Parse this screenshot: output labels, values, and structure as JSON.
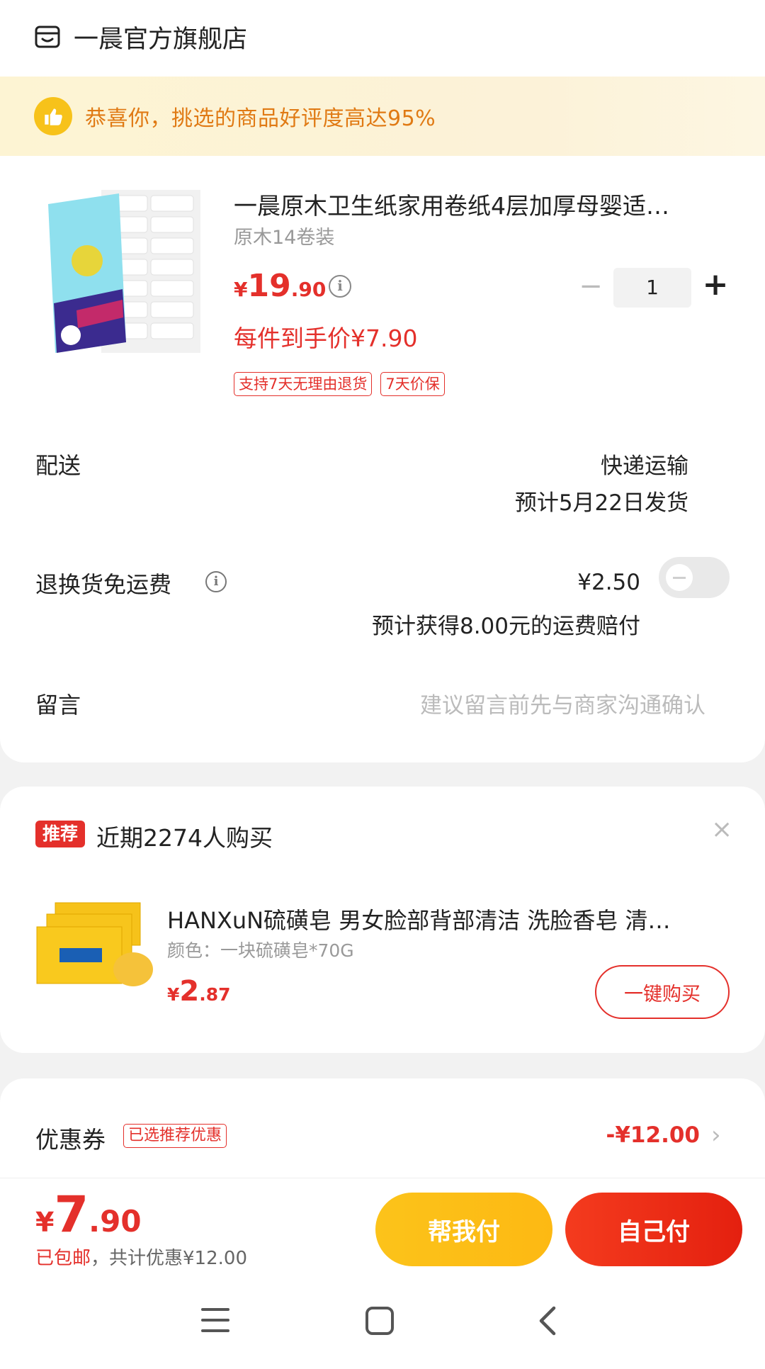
{
  "shop": {
    "name": "一晨官方旗舰店",
    "icon": "store-icon"
  },
  "banner": {
    "text": "恭喜你，挑选的商品好评度高达95%",
    "icon": "thumbs-up-icon",
    "accent": "#e07a14"
  },
  "product": {
    "title": "一晨原木卫生纸家用卷纸4层加厚母婴适…",
    "spec": "原木14卷装",
    "price": {
      "symbol": "¥",
      "integer": "19",
      "decimal": ".90"
    },
    "quantity": "1",
    "unit_price_text": "每件到手价¥7.90",
    "tags": [
      "支持7天无理由退货",
      "7天价保"
    ]
  },
  "delivery": {
    "label": "配送",
    "type": "快递运输",
    "date": "预计5月22日发货"
  },
  "return_insurance": {
    "label": "退换货免运费",
    "price": "¥2.50",
    "sub": "预计获得8.00元的运费赔付",
    "enabled": false
  },
  "message": {
    "label": "留言",
    "placeholder": "建议留言前先与商家沟通确认"
  },
  "recommend": {
    "badge": "推荐",
    "text": "近期2274人购买",
    "item": {
      "title": "HANXuN硫磺皂 男女脸部背部清洁 洗脸香皂 清…",
      "spec": "颜色：一块硫磺皂*70G",
      "price": {
        "symbol": "¥",
        "integer": "2",
        "decimal": ".87"
      },
      "buy_label": "一键购买"
    }
  },
  "coupon": {
    "label": "优惠券",
    "tag": "已选推荐优惠",
    "amount": "-¥12.00"
  },
  "bottom": {
    "total": {
      "symbol": "¥",
      "integer": "7",
      "decimal": ".90"
    },
    "shipping": "已包邮",
    "discount": "，共计优惠¥12.00",
    "help_pay": "帮我付",
    "self_pay": "自己付"
  },
  "colors": {
    "primary_red": "#e4302b",
    "yellow": "#fcc31a",
    "orange_text": "#e07a14"
  }
}
